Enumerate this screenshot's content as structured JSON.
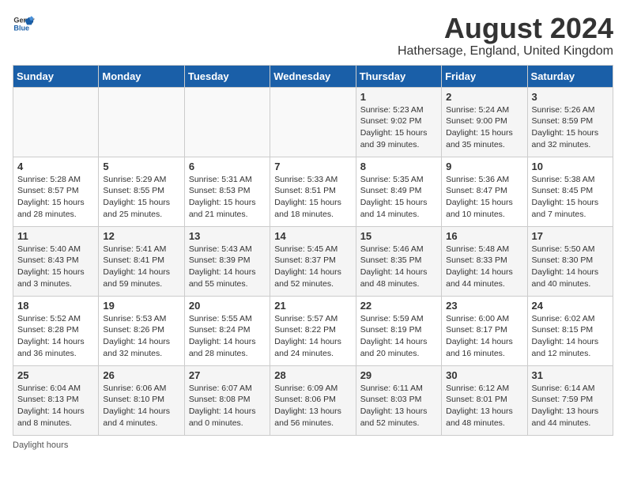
{
  "header": {
    "logo_general": "General",
    "logo_blue": "Blue",
    "title": "August 2024",
    "subtitle": "Hathersage, England, United Kingdom"
  },
  "days_of_week": [
    "Sunday",
    "Monday",
    "Tuesday",
    "Wednesday",
    "Thursday",
    "Friday",
    "Saturday"
  ],
  "weeks": [
    [
      {
        "day": "",
        "sunrise": "",
        "sunset": "",
        "daylight": ""
      },
      {
        "day": "",
        "sunrise": "",
        "sunset": "",
        "daylight": ""
      },
      {
        "day": "",
        "sunrise": "",
        "sunset": "",
        "daylight": ""
      },
      {
        "day": "",
        "sunrise": "",
        "sunset": "",
        "daylight": ""
      },
      {
        "day": "1",
        "sunrise": "Sunrise: 5:23 AM",
        "sunset": "Sunset: 9:02 PM",
        "daylight": "Daylight: 15 hours and 39 minutes."
      },
      {
        "day": "2",
        "sunrise": "Sunrise: 5:24 AM",
        "sunset": "Sunset: 9:00 PM",
        "daylight": "Daylight: 15 hours and 35 minutes."
      },
      {
        "day": "3",
        "sunrise": "Sunrise: 5:26 AM",
        "sunset": "Sunset: 8:59 PM",
        "daylight": "Daylight: 15 hours and 32 minutes."
      }
    ],
    [
      {
        "day": "4",
        "sunrise": "Sunrise: 5:28 AM",
        "sunset": "Sunset: 8:57 PM",
        "daylight": "Daylight: 15 hours and 28 minutes."
      },
      {
        "day": "5",
        "sunrise": "Sunrise: 5:29 AM",
        "sunset": "Sunset: 8:55 PM",
        "daylight": "Daylight: 15 hours and 25 minutes."
      },
      {
        "day": "6",
        "sunrise": "Sunrise: 5:31 AM",
        "sunset": "Sunset: 8:53 PM",
        "daylight": "Daylight: 15 hours and 21 minutes."
      },
      {
        "day": "7",
        "sunrise": "Sunrise: 5:33 AM",
        "sunset": "Sunset: 8:51 PM",
        "daylight": "Daylight: 15 hours and 18 minutes."
      },
      {
        "day": "8",
        "sunrise": "Sunrise: 5:35 AM",
        "sunset": "Sunset: 8:49 PM",
        "daylight": "Daylight: 15 hours and 14 minutes."
      },
      {
        "day": "9",
        "sunrise": "Sunrise: 5:36 AM",
        "sunset": "Sunset: 8:47 PM",
        "daylight": "Daylight: 15 hours and 10 minutes."
      },
      {
        "day": "10",
        "sunrise": "Sunrise: 5:38 AM",
        "sunset": "Sunset: 8:45 PM",
        "daylight": "Daylight: 15 hours and 7 minutes."
      }
    ],
    [
      {
        "day": "11",
        "sunrise": "Sunrise: 5:40 AM",
        "sunset": "Sunset: 8:43 PM",
        "daylight": "Daylight: 15 hours and 3 minutes."
      },
      {
        "day": "12",
        "sunrise": "Sunrise: 5:41 AM",
        "sunset": "Sunset: 8:41 PM",
        "daylight": "Daylight: 14 hours and 59 minutes."
      },
      {
        "day": "13",
        "sunrise": "Sunrise: 5:43 AM",
        "sunset": "Sunset: 8:39 PM",
        "daylight": "Daylight: 14 hours and 55 minutes."
      },
      {
        "day": "14",
        "sunrise": "Sunrise: 5:45 AM",
        "sunset": "Sunset: 8:37 PM",
        "daylight": "Daylight: 14 hours and 52 minutes."
      },
      {
        "day": "15",
        "sunrise": "Sunrise: 5:46 AM",
        "sunset": "Sunset: 8:35 PM",
        "daylight": "Daylight: 14 hours and 48 minutes."
      },
      {
        "day": "16",
        "sunrise": "Sunrise: 5:48 AM",
        "sunset": "Sunset: 8:33 PM",
        "daylight": "Daylight: 14 hours and 44 minutes."
      },
      {
        "day": "17",
        "sunrise": "Sunrise: 5:50 AM",
        "sunset": "Sunset: 8:30 PM",
        "daylight": "Daylight: 14 hours and 40 minutes."
      }
    ],
    [
      {
        "day": "18",
        "sunrise": "Sunrise: 5:52 AM",
        "sunset": "Sunset: 8:28 PM",
        "daylight": "Daylight: 14 hours and 36 minutes."
      },
      {
        "day": "19",
        "sunrise": "Sunrise: 5:53 AM",
        "sunset": "Sunset: 8:26 PM",
        "daylight": "Daylight: 14 hours and 32 minutes."
      },
      {
        "day": "20",
        "sunrise": "Sunrise: 5:55 AM",
        "sunset": "Sunset: 8:24 PM",
        "daylight": "Daylight: 14 hours and 28 minutes."
      },
      {
        "day": "21",
        "sunrise": "Sunrise: 5:57 AM",
        "sunset": "Sunset: 8:22 PM",
        "daylight": "Daylight: 14 hours and 24 minutes."
      },
      {
        "day": "22",
        "sunrise": "Sunrise: 5:59 AM",
        "sunset": "Sunset: 8:19 PM",
        "daylight": "Daylight: 14 hours and 20 minutes."
      },
      {
        "day": "23",
        "sunrise": "Sunrise: 6:00 AM",
        "sunset": "Sunset: 8:17 PM",
        "daylight": "Daylight: 14 hours and 16 minutes."
      },
      {
        "day": "24",
        "sunrise": "Sunrise: 6:02 AM",
        "sunset": "Sunset: 8:15 PM",
        "daylight": "Daylight: 14 hours and 12 minutes."
      }
    ],
    [
      {
        "day": "25",
        "sunrise": "Sunrise: 6:04 AM",
        "sunset": "Sunset: 8:13 PM",
        "daylight": "Daylight: 14 hours and 8 minutes."
      },
      {
        "day": "26",
        "sunrise": "Sunrise: 6:06 AM",
        "sunset": "Sunset: 8:10 PM",
        "daylight": "Daylight: 14 hours and 4 minutes."
      },
      {
        "day": "27",
        "sunrise": "Sunrise: 6:07 AM",
        "sunset": "Sunset: 8:08 PM",
        "daylight": "Daylight: 14 hours and 0 minutes."
      },
      {
        "day": "28",
        "sunrise": "Sunrise: 6:09 AM",
        "sunset": "Sunset: 8:06 PM",
        "daylight": "Daylight: 13 hours and 56 minutes."
      },
      {
        "day": "29",
        "sunrise": "Sunrise: 6:11 AM",
        "sunset": "Sunset: 8:03 PM",
        "daylight": "Daylight: 13 hours and 52 minutes."
      },
      {
        "day": "30",
        "sunrise": "Sunrise: 6:12 AM",
        "sunset": "Sunset: 8:01 PM",
        "daylight": "Daylight: 13 hours and 48 minutes."
      },
      {
        "day": "31",
        "sunrise": "Sunrise: 6:14 AM",
        "sunset": "Sunset: 7:59 PM",
        "daylight": "Daylight: 13 hours and 44 minutes."
      }
    ]
  ],
  "footer": {
    "note": "Daylight hours"
  }
}
